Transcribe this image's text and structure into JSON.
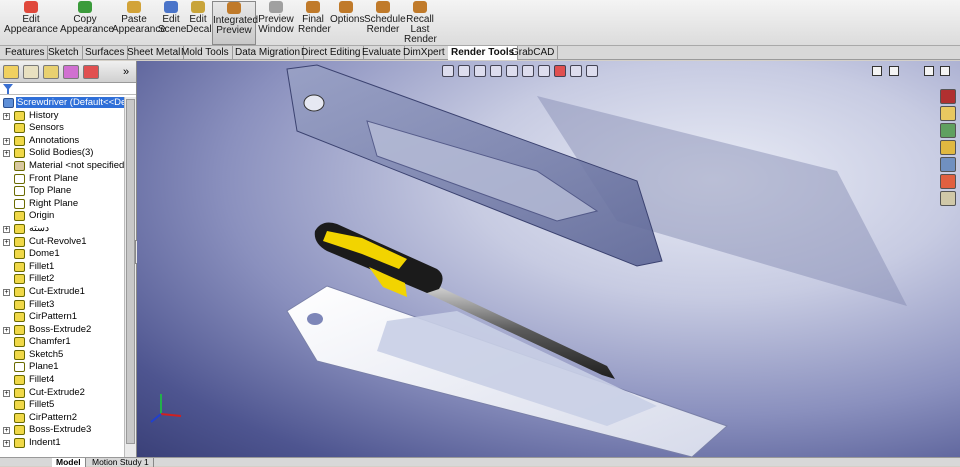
{
  "ribbon": {
    "buttons": [
      {
        "label": "Edit\nAppearance",
        "icon": "sphere-color-icon",
        "color": "#e0483b"
      },
      {
        "label": "Copy\nAppearance",
        "icon": "copy-appearance-icon",
        "color": "#3b9b3b"
      },
      {
        "label": "Paste\nAppearance",
        "icon": "paste-appearance-icon",
        "color": "#d2a339"
      },
      {
        "label": "Edit\nScene",
        "icon": "scene-icon",
        "color": "#4a74c9"
      },
      {
        "label": "Edit\nDecal",
        "icon": "decal-icon",
        "color": "#c8a43a"
      },
      {
        "label": "Integrated\nPreview",
        "icon": "integrated-preview-icon",
        "color": "#c07a2a"
      },
      {
        "label": "Preview\nWindow",
        "icon": "preview-window-icon",
        "color": "#a0a0a0"
      },
      {
        "label": "Final\nRender",
        "icon": "teapot-icon",
        "color": "#c07a2a"
      },
      {
        "label": "Options",
        "icon": "options-icon",
        "color": "#c07a2a"
      },
      {
        "label": "Schedule\nRender",
        "icon": "schedule-render-icon",
        "color": "#c07a2a"
      },
      {
        "label": "Recall\nLast\nRender",
        "icon": "recall-render-icon",
        "color": "#c07a2a"
      }
    ]
  },
  "tabs": [
    "Features",
    "Sketch",
    "Surfaces",
    "Sheet Metal",
    "Mold Tools",
    "Data Migration",
    "Direct Editing",
    "Evaluate",
    "DimXpert",
    "Render Tools",
    "GrabCAD"
  ],
  "active_tab": "Render Tools",
  "tree": {
    "root": "Screwdriver  (Default<<Defau",
    "items": [
      {
        "label": "History",
        "expand": true,
        "icon": "history-icon"
      },
      {
        "label": "Sensors",
        "expand": false,
        "icon": "sensor-icon"
      },
      {
        "label": "Annotations",
        "expand": true,
        "icon": "annotations-icon"
      },
      {
        "label": "Solid Bodies(3)",
        "expand": true,
        "icon": "solid-bodies-icon"
      },
      {
        "label": "Material <not specified>",
        "expand": false,
        "icon": "material-icon"
      },
      {
        "label": "Front Plane",
        "expand": false,
        "icon": "plane-icon"
      },
      {
        "label": "Top Plane",
        "expand": false,
        "icon": "plane-icon"
      },
      {
        "label": "Right Plane",
        "expand": false,
        "icon": "plane-icon"
      },
      {
        "label": "Origin",
        "expand": false,
        "icon": "origin-icon"
      },
      {
        "label": "دسته",
        "expand": true,
        "icon": "feature-icon"
      },
      {
        "label": "Cut-Revolve1",
        "expand": true,
        "icon": "cut-revolve-icon"
      },
      {
        "label": "Dome1",
        "expand": false,
        "icon": "dome-icon"
      },
      {
        "label": "Fillet1",
        "expand": false,
        "icon": "fillet-icon"
      },
      {
        "label": "Fillet2",
        "expand": false,
        "icon": "fillet-icon"
      },
      {
        "label": "Cut-Extrude1",
        "expand": true,
        "icon": "cut-extrude-icon"
      },
      {
        "label": "Fillet3",
        "expand": false,
        "icon": "fillet-icon"
      },
      {
        "label": "CirPattern1",
        "expand": false,
        "icon": "circular-pattern-icon"
      },
      {
        "label": "Boss-Extrude2",
        "expand": true,
        "icon": "boss-extrude-icon"
      },
      {
        "label": "Chamfer1",
        "expand": false,
        "icon": "chamfer-icon"
      },
      {
        "label": "Sketch5",
        "expand": false,
        "icon": "sketch-icon"
      },
      {
        "label": "Plane1",
        "expand": false,
        "icon": "plane-icon"
      },
      {
        "label": "Fillet4",
        "expand": false,
        "icon": "fillet-icon"
      },
      {
        "label": "Cut-Extrude2",
        "expand": true,
        "icon": "cut-extrude-icon"
      },
      {
        "label": "Fillet5",
        "expand": false,
        "icon": "fillet-icon"
      },
      {
        "label": "CirPattern2",
        "expand": false,
        "icon": "circular-pattern-icon"
      },
      {
        "label": "Boss-Extrude3",
        "expand": true,
        "icon": "boss-extrude-icon"
      },
      {
        "label": "Indent1",
        "expand": true,
        "icon": "indent-icon"
      }
    ]
  },
  "bottom_tabs": [
    "Model",
    "Motion Study 1"
  ],
  "active_bottom_tab": "Model",
  "colors": {
    "handle_yellow": "#f2d400",
    "handle_black": "#1b1b1b",
    "selection_blue": "#2f6fd8",
    "viewport_deep": "#3a4078"
  }
}
